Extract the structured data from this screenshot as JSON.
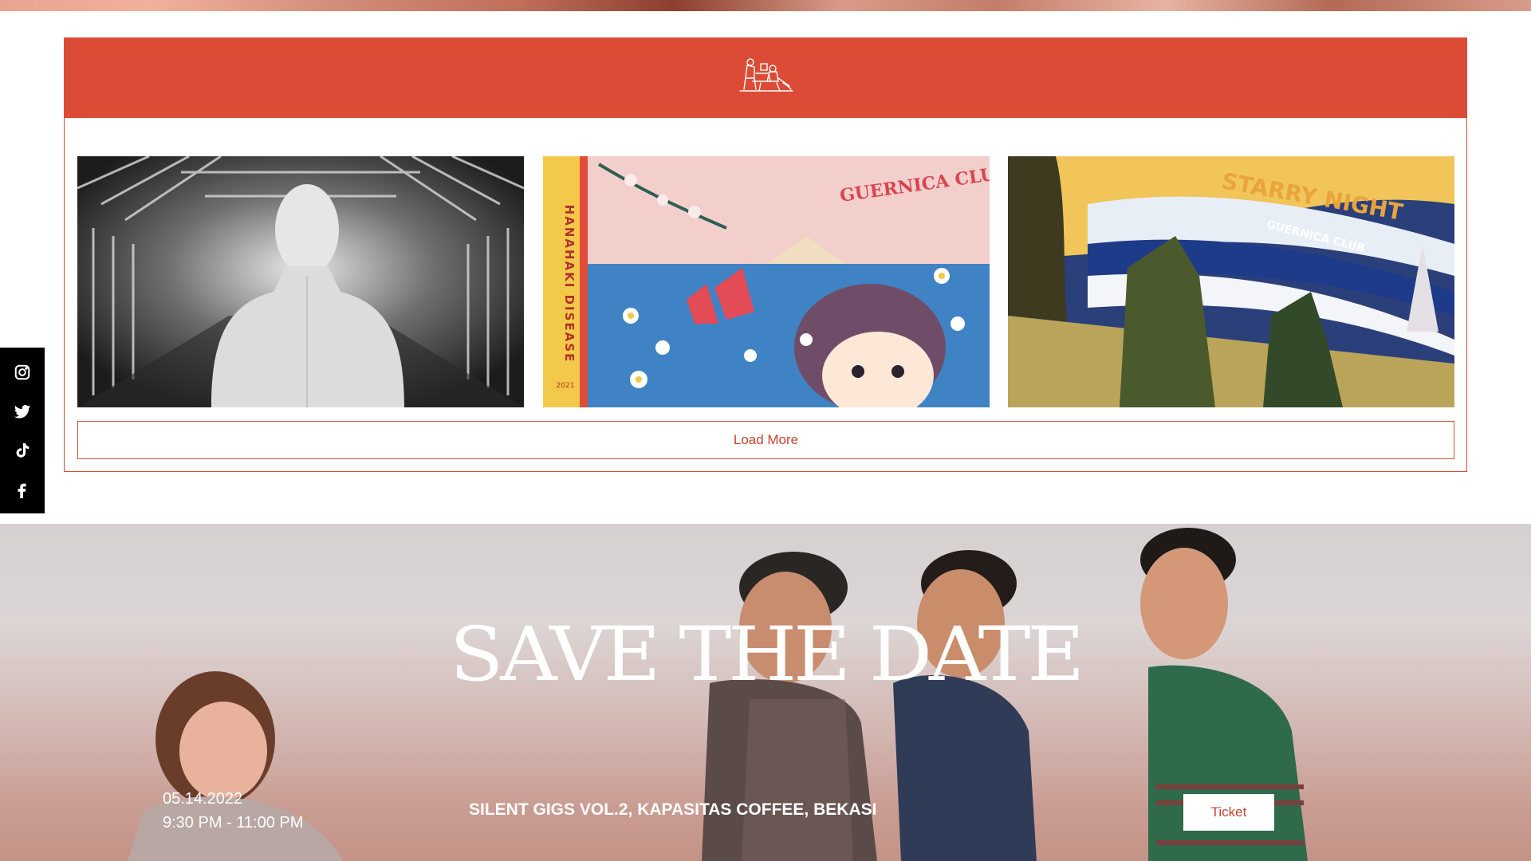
{
  "social": {
    "items": [
      {
        "name": "instagram-icon"
      },
      {
        "name": "twitter-icon"
      },
      {
        "name": "tiktok-icon"
      },
      {
        "name": "facebook-icon"
      }
    ]
  },
  "gallery": {
    "logo_icon": "band-illustration-logo",
    "thumbnails": [
      {
        "title": ""
      },
      {
        "title": "GUERNICA CLUB",
        "side_text": "HANAHAKI DISEASE",
        "year": "2021"
      },
      {
        "title": "STARRY NIGHT",
        "subtitle": "GUERNICA CLUB"
      }
    ],
    "load_more_label": "Load More"
  },
  "event": {
    "heading": "SAVE THE DATE",
    "date": "05.14.2022",
    "time": "9:30 PM - 11:00 PM",
    "name": "SILENT GIGS VOL.2, KAPASITAS COFFEE, BEKASI",
    "ticket_label": "Ticket"
  },
  "colors": {
    "accent": "#dc4b36",
    "sidebar": "#000000"
  }
}
